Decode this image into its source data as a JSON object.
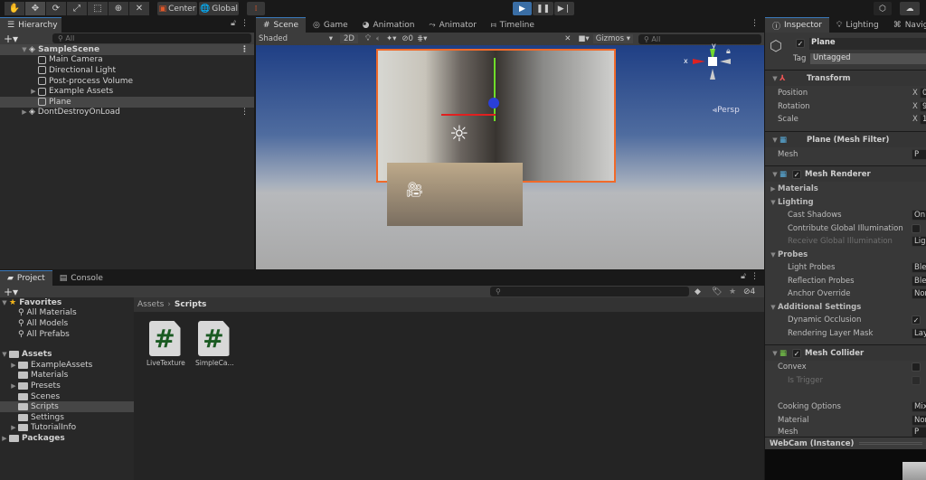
{
  "toolbar": {
    "tools": [
      "hand-tool",
      "move-tool",
      "rotate-tool",
      "scale-tool",
      "rect-tool",
      "transform-tool",
      "custom-tool"
    ],
    "pivot": "Center",
    "space": "Global",
    "play": "play",
    "pause": "pause",
    "step": "step"
  },
  "hierarchy": {
    "title": "Hierarchy",
    "search_placeholder": "All",
    "scene": "SampleScene",
    "items": [
      "Main Camera",
      "Directional Light",
      "Post-process Volume",
      "Example Assets",
      "Plane"
    ],
    "dont_destroy": "DontDestroyOnLoad"
  },
  "scene": {
    "tabs": [
      "Scene",
      "Game",
      "Animation",
      "Animator",
      "Timeline"
    ],
    "shading": "Shaded",
    "mode_2d": "2D",
    "hidden_count": "0",
    "gizmos": "Gizmos",
    "search_placeholder": "All",
    "axis_y": "y",
    "axis_x": "x",
    "projection": "Persp"
  },
  "project": {
    "tabs": [
      "Project",
      "Console"
    ],
    "favorites": "Favorites",
    "fav_items": [
      "All Materials",
      "All Models",
      "All Prefabs"
    ],
    "assets": "Assets",
    "asset_folders": [
      "ExampleAssets",
      "Materials",
      "Presets",
      "Scenes",
      "Scripts",
      "Settings",
      "TutorialInfo"
    ],
    "packages": "Packages",
    "breadcrumb": [
      "Assets",
      "Scripts"
    ],
    "files": [
      "LiveTexture",
      "SimpleCa..."
    ],
    "hidden_count": "4"
  },
  "inspector": {
    "tabs": [
      "Inspector",
      "Lighting",
      "Naviga"
    ],
    "object_name": "Plane",
    "tag_label": "Tag",
    "tag": "Untagged",
    "transform": {
      "title": "Transform",
      "rows": [
        {
          "label": "Position",
          "axis": "X",
          "value": "0"
        },
        {
          "label": "Rotation",
          "axis": "X",
          "value": "9"
        },
        {
          "label": "Scale",
          "axis": "X",
          "value": "1."
        }
      ]
    },
    "mesh_filter": {
      "title": "Plane (Mesh Filter)",
      "mesh_label": "Mesh",
      "mesh_value": "P"
    },
    "mesh_renderer": {
      "title": "Mesh Renderer",
      "materials": "Materials",
      "lighting": "Lighting",
      "cast_shadows": "Cast Shadows",
      "cast_shadows_value": "On",
      "contribute_gi": "Contribute Global Illumination",
      "receive_gi": "Receive Global Illumination",
      "receive_gi_value": "Lig",
      "probes": "Probes",
      "light_probes": "Light Probes",
      "light_probes_value": "Ble",
      "reflection_probes": "Reflection Probes",
      "reflection_probes_value": "Ble",
      "anchor_override": "Anchor Override",
      "anchor_override_value": "Nor",
      "additional": "Additional Settings",
      "dynamic_occlusion": "Dynamic Occlusion",
      "rendering_layer": "Rendering Layer Mask",
      "rendering_layer_value": "Lay"
    },
    "mesh_collider": {
      "title": "Mesh Collider",
      "convex": "Convex",
      "is_trigger": "Is Trigger",
      "cooking": "Cooking Options",
      "cooking_value": "Mix",
      "material": "Material",
      "material_value": "Nor",
      "mesh": "Mesh",
      "mesh_value": "P"
    },
    "preview_title": "WebCam (Instance)"
  }
}
